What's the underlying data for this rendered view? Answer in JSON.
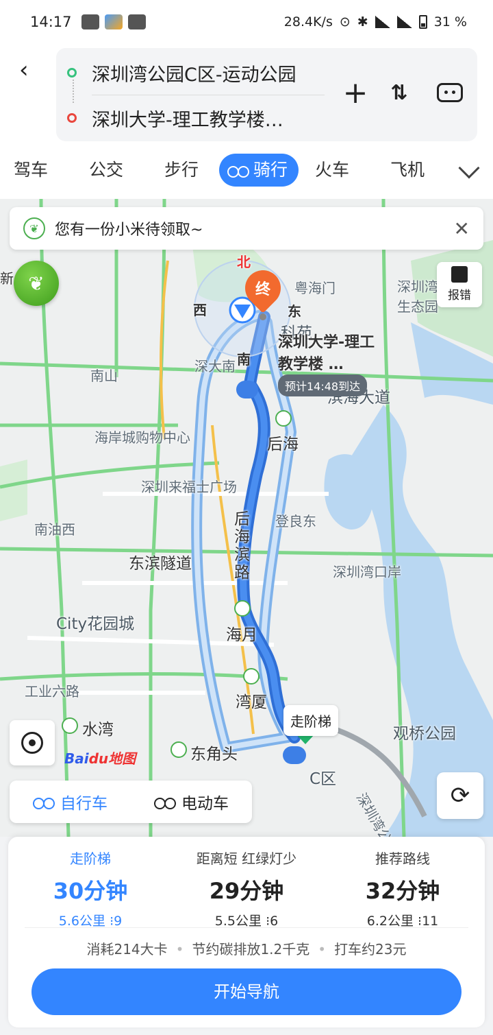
{
  "status_bar": {
    "time": "14:17",
    "speed": "28.4K/s",
    "battery": "31 %"
  },
  "route": {
    "start": "深圳湾公园C区-运动公园",
    "end": "深圳大学-理工教学楼…"
  },
  "modes": [
    "驾车",
    "公交",
    "步行",
    "骑行",
    "火车",
    "飞机"
  ],
  "active_mode": "骑行",
  "banner": {
    "text": "您有一份小米待领取~"
  },
  "report_label": "报错",
  "map_labels": {
    "north": "北",
    "west": "西",
    "east": "东",
    "south": "南",
    "yuehaimen": "粤海门",
    "kehua": "科苑",
    "shenzhenwan_eco": "深圳湾生态园",
    "dest_name": "深圳大学-理工教学楼 …",
    "shendanan": "深大南",
    "nanshan": "南山",
    "binhai": "滨海大道",
    "houhai": "后海",
    "haian": "海岸城购物中心",
    "laifushi": "深圳来福士广场",
    "nanyouxi": "南油西",
    "dengliang": "登良东",
    "dongbin": "东滨隧道",
    "houhaibin": "后海滨路",
    "kouan": "深圳湾口岸",
    "city": "City花园城",
    "haiyue": "海月",
    "gongye": "工业六路",
    "wanxia": "湾厦",
    "shuiwan": "水湾",
    "dongjiaotou": "东角头",
    "guanqiao": "观桥公园",
    "c_area": "C区",
    "gonglu": "深圳湾公路",
    "xin": "新",
    "end_pin": "终",
    "eta": "预计14:48到达",
    "stairs": "走阶梯",
    "baidu": "Bai",
    "baidu2": "du地图"
  },
  "vehicle_tabs": [
    "自行车",
    "电动车"
  ],
  "routes": [
    {
      "tag": "走阶梯",
      "time": "30分钟",
      "distance": "5.6公里",
      "lights": "9"
    },
    {
      "tag": "距离短 红绿灯少",
      "time": "29分钟",
      "distance": "5.5公里",
      "lights": "6"
    },
    {
      "tag": "推荐路线",
      "time": "32分钟",
      "distance": "6.2公里",
      "lights": "11"
    }
  ],
  "stats": {
    "calories": "消耗214大卡",
    "carbon": "节约碳排放1.2千克",
    "taxi": "打车约23元"
  },
  "nav_button": "开始导航",
  "colors": {
    "primary": "#3385ff",
    "route": "#3d7fe6",
    "alt_route": "#a8cdf5",
    "road_green": "#6fd07b"
  }
}
